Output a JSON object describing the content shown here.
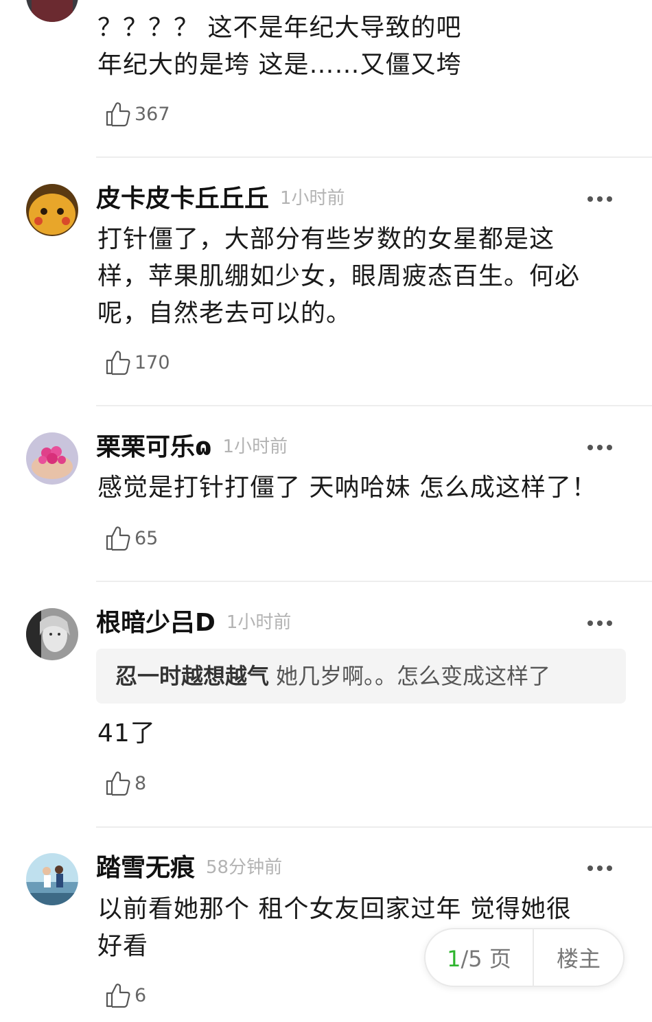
{
  "comments": [
    {
      "lines": [
        "？？？？ 这不是年纪大导致的吧",
        "年纪大的是垮  这是……又僵又垮"
      ],
      "likes": "367"
    },
    {
      "username": "皮卡皮卡丘丘丘",
      "time": "1小时前",
      "lines": [
        "打针僵了，大部分有些岁数的女星都是这",
        "样，苹果肌绷如少女，眼周疲态百生。何必",
        "呢，自然老去可以的。"
      ],
      "likes": "170"
    },
    {
      "username": "栗栗可乐ɷ",
      "time": "1小时前",
      "lines": [
        "感觉是打针打僵了 天呐哈妹 怎么成这样了！"
      ],
      "likes": "65"
    },
    {
      "username": "根暗少吕D",
      "time": "1小时前",
      "quote_user": "忍一时越想越气",
      "quote_text": "她几岁啊。。怎么变成这样了",
      "lines": [
        "41了"
      ],
      "likes": "8"
    },
    {
      "username": "踏雪无痕",
      "time": "58分钟前",
      "lines": [
        "以前看她那个  租个女友回家过年  觉得她很",
        "好看"
      ],
      "likes": "6"
    }
  ],
  "pager": {
    "current": "1",
    "total": "/5 页",
    "owner_label": "楼主"
  }
}
